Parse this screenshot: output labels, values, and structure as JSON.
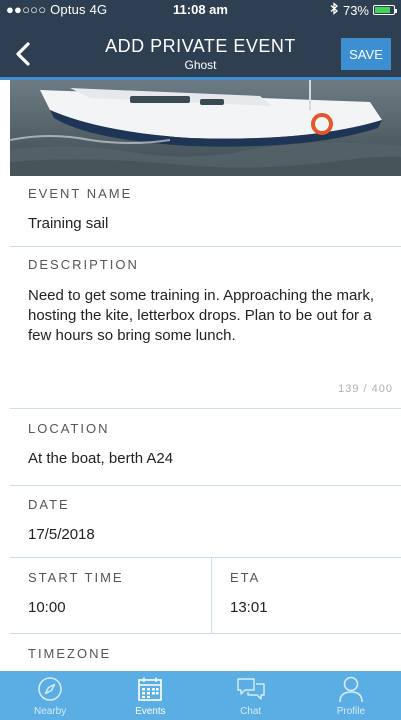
{
  "status_bar": {
    "carrier": "●●○○○ Optus  4G",
    "time": "11:08 am",
    "battery": "73%",
    "battery_level": 0.73
  },
  "header": {
    "title": "ADD PRIVATE EVENT",
    "subtitle": "Ghost",
    "save_label": "SAVE"
  },
  "form": {
    "event_name": {
      "label": "EVENT NAME",
      "value": "Training sail"
    },
    "description": {
      "label": "DESCRIPTION",
      "value": "Need to get some training in. Approaching the mark, hosting the kite, letterbox drops. Plan to be out for a few hours so bring some lunch.",
      "counter": "139 / 400"
    },
    "location": {
      "label": "LOCATION",
      "value": "At the boat, berth A24"
    },
    "date": {
      "label": "DATE",
      "value": "17/5/2018"
    },
    "start_time": {
      "label": "START TIME",
      "value": "10:00"
    },
    "eta": {
      "label": "ETA",
      "value": "13:01"
    },
    "timezone": {
      "label": "TIMEZONE"
    }
  },
  "tabs": [
    {
      "label": "Nearby",
      "icon": "compass-icon"
    },
    {
      "label": "Events",
      "icon": "calendar-icon",
      "active": true
    },
    {
      "label": "Chat",
      "icon": "chat-icon"
    },
    {
      "label": "Profile",
      "icon": "profile-icon"
    }
  ],
  "colors": {
    "header_bg": "#2f3f52",
    "accent": "#3d8fd1",
    "tabbar_bg": "#5aaee3",
    "divider": "#cde0ea"
  }
}
